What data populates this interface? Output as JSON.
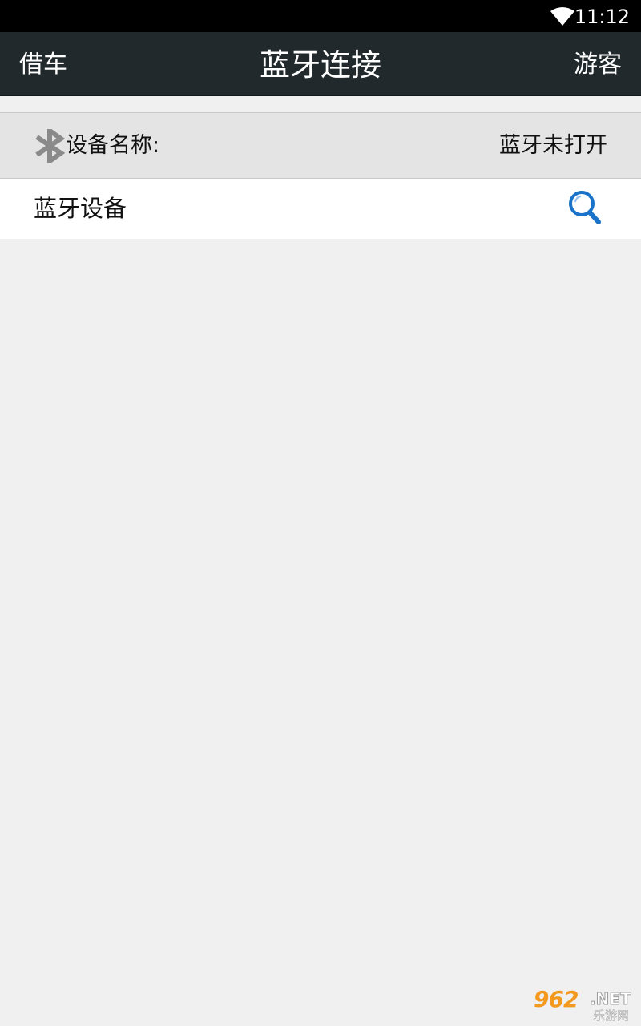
{
  "status_bar": {
    "time": "11:12",
    "icon": "wifi-icon"
  },
  "action_bar": {
    "left_label": "借车",
    "title": "蓝牙连接",
    "right_label": "游客"
  },
  "device_header": {
    "icon": "bluetooth-icon",
    "label": "设备名称:",
    "status": "蓝牙未打开"
  },
  "device_row": {
    "label": "蓝牙设备",
    "icon": "search-icon"
  },
  "watermark": {
    "brand": "962",
    "brand_suffix": ".NET",
    "sub": "乐游网"
  },
  "colors": {
    "action_bar_bg": "#21292d",
    "page_bg": "#f0f0f0",
    "header_bg": "#e4e4e4",
    "search_icon": "#1a73c8",
    "bluetooth_icon": "#8a8a8a"
  }
}
